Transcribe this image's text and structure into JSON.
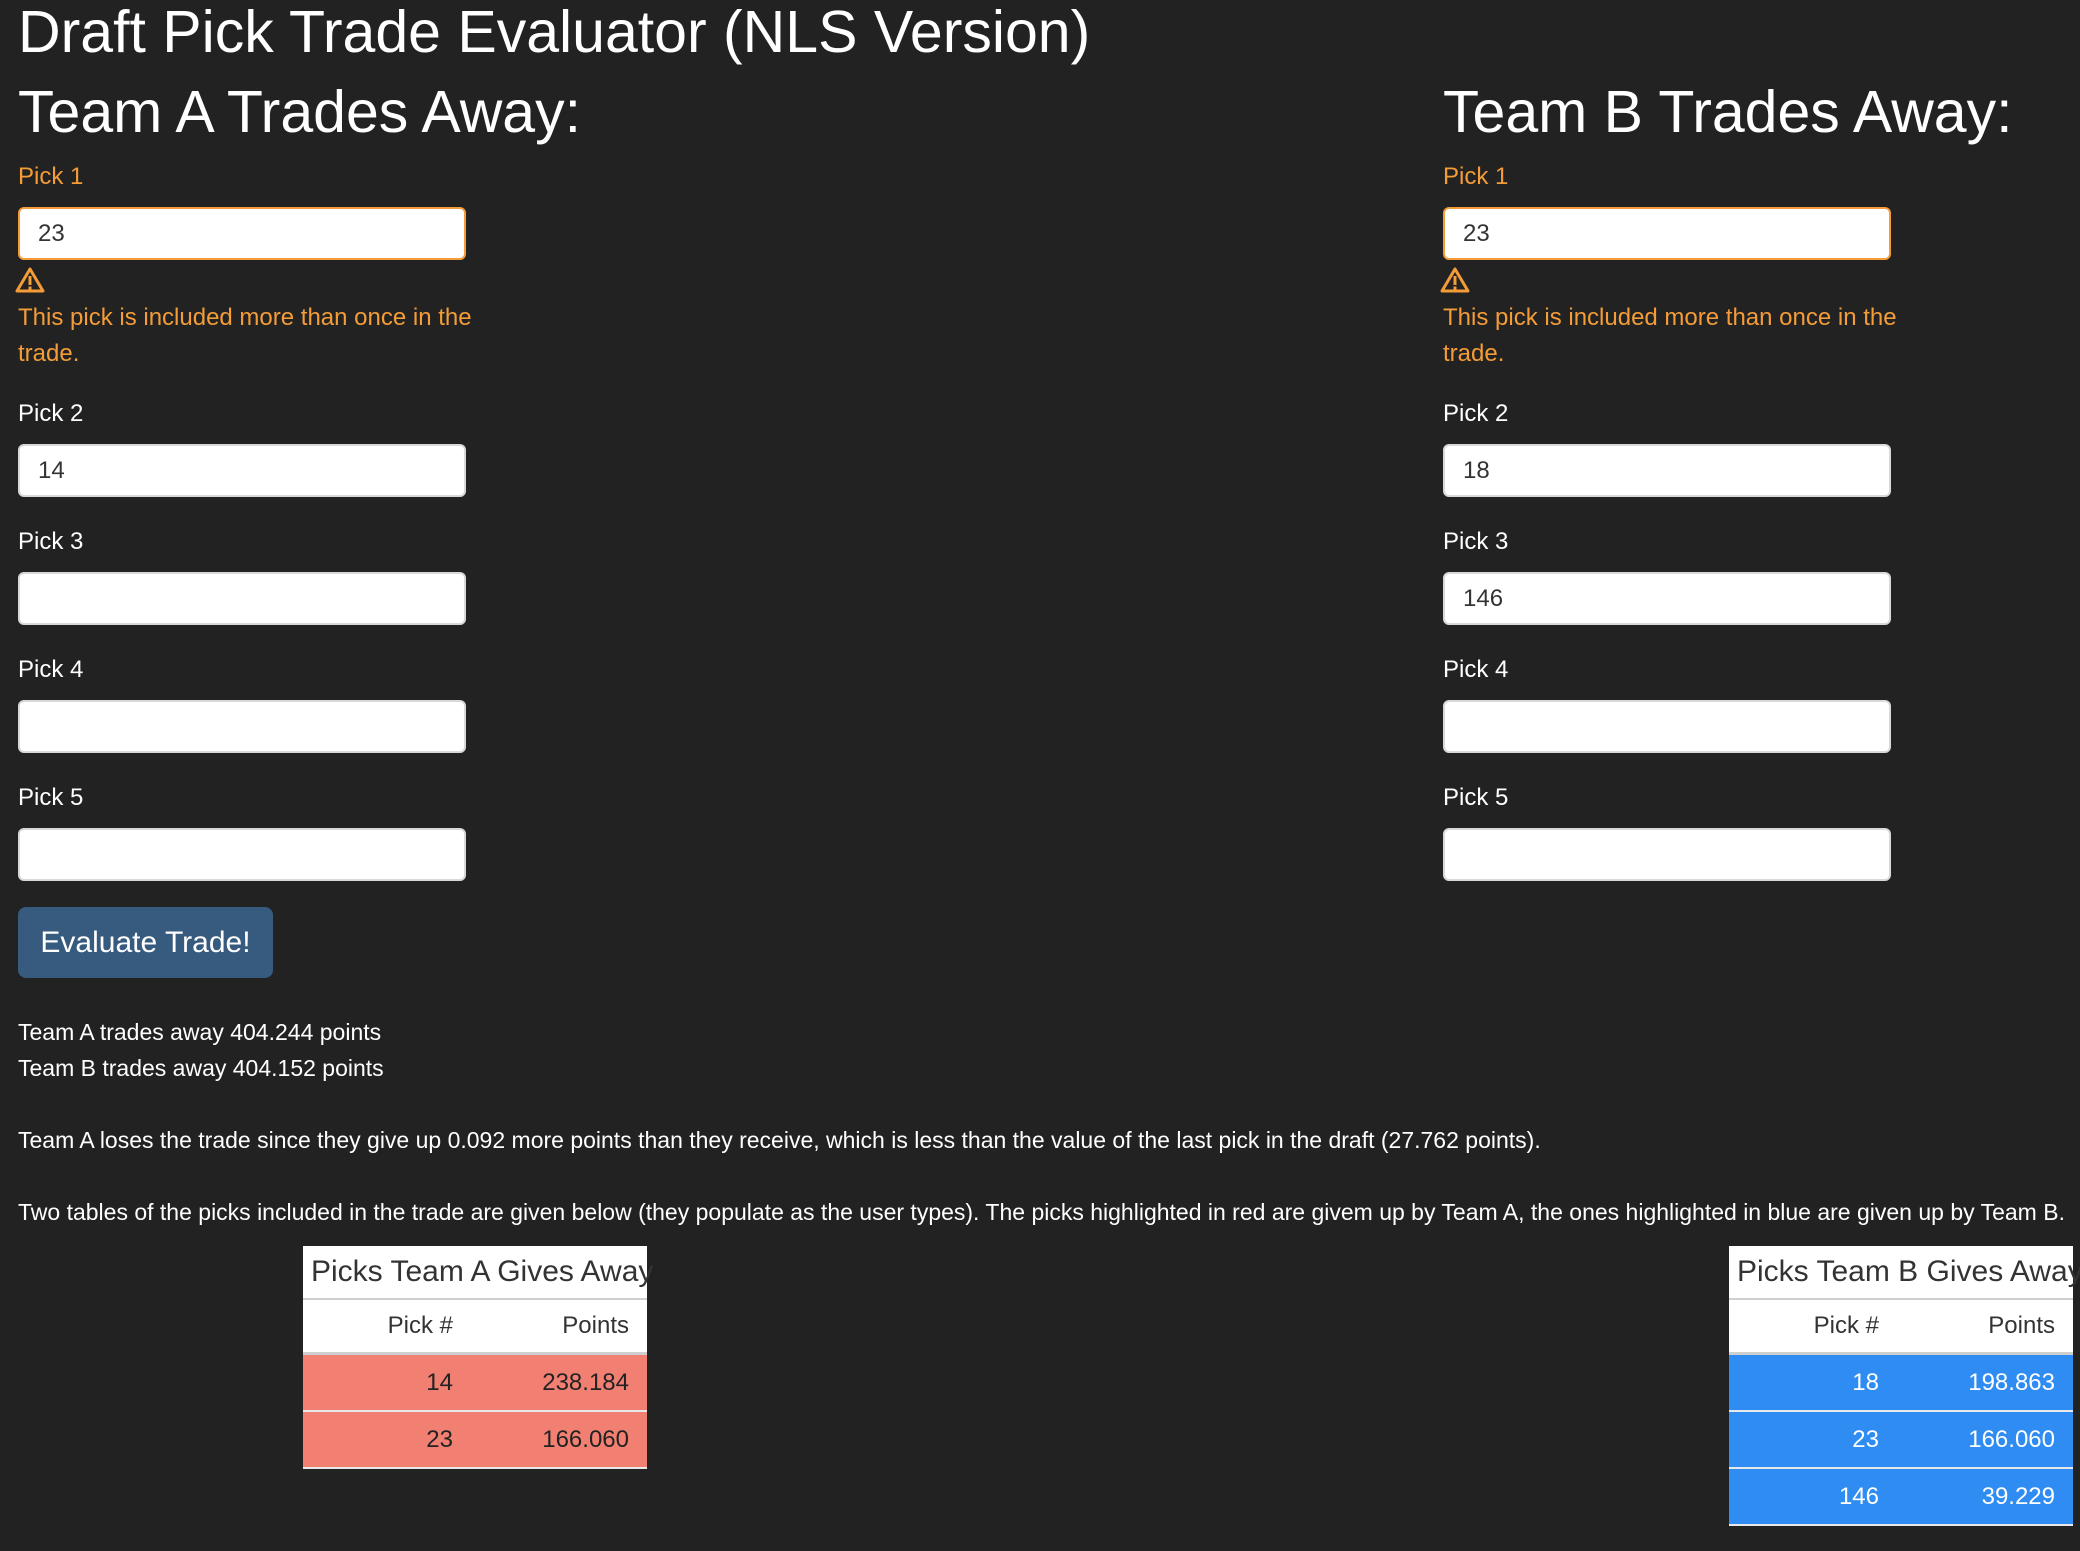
{
  "app": {
    "title": "Draft Pick Trade Evaluator (NLS Version)"
  },
  "colors": {
    "background": "#222222",
    "warning": "#f39c38",
    "button": "#375a7f",
    "team_a_highlight": "#f28072",
    "team_b_highlight": "#2e8cf2"
  },
  "team_a": {
    "heading": "Team A Trades Away:",
    "picks": [
      {
        "label": "Pick 1",
        "value": "23",
        "warning": true
      },
      {
        "label": "Pick 2",
        "value": "14",
        "warning": false
      },
      {
        "label": "Pick 3",
        "value": "",
        "warning": false
      },
      {
        "label": "Pick 4",
        "value": "",
        "warning": false
      },
      {
        "label": "Pick 5",
        "value": "",
        "warning": false
      }
    ],
    "warning_icon": "warning-triangle-icon",
    "warning_message": "This pick is included more than once in the trade."
  },
  "team_b": {
    "heading": "Team B Trades Away:",
    "picks": [
      {
        "label": "Pick 1",
        "value": "23",
        "warning": true
      },
      {
        "label": "Pick 2",
        "value": "18",
        "warning": false
      },
      {
        "label": "Pick 3",
        "value": "146",
        "warning": false
      },
      {
        "label": "Pick 4",
        "value": "",
        "warning": false
      },
      {
        "label": "Pick 5",
        "value": "",
        "warning": false
      }
    ],
    "warning_icon": "warning-triangle-icon",
    "warning_message": "This pick is included more than once in the trade."
  },
  "evaluate_button": {
    "label": "Evaluate Trade!"
  },
  "results": {
    "team_a_summary": "Team A trades away 404.244 points",
    "team_b_summary": "Team B trades away 404.152 points",
    "verdict": "Team A loses the trade since they give up 0.092 more points than they receive, which is less than the value of the last pick in the draft (27.762 points).",
    "tables_note": "Two tables of the picks included in the trade are given below (they populate as the user types). The picks highlighted in red are givem up by Team A, the ones highlighted in blue are given up by Team B."
  },
  "table_a": {
    "caption": "Picks Team A Gives Away",
    "columns": [
      "Pick #",
      "Points"
    ],
    "rows": [
      [
        "14",
        "238.184"
      ],
      [
        "23",
        "166.060"
      ]
    ]
  },
  "table_b": {
    "caption": "Picks Team B Gives Away",
    "columns": [
      "Pick #",
      "Points"
    ],
    "rows": [
      [
        "18",
        "198.863"
      ],
      [
        "23",
        "166.060"
      ],
      [
        "146",
        "39.229"
      ]
    ]
  }
}
